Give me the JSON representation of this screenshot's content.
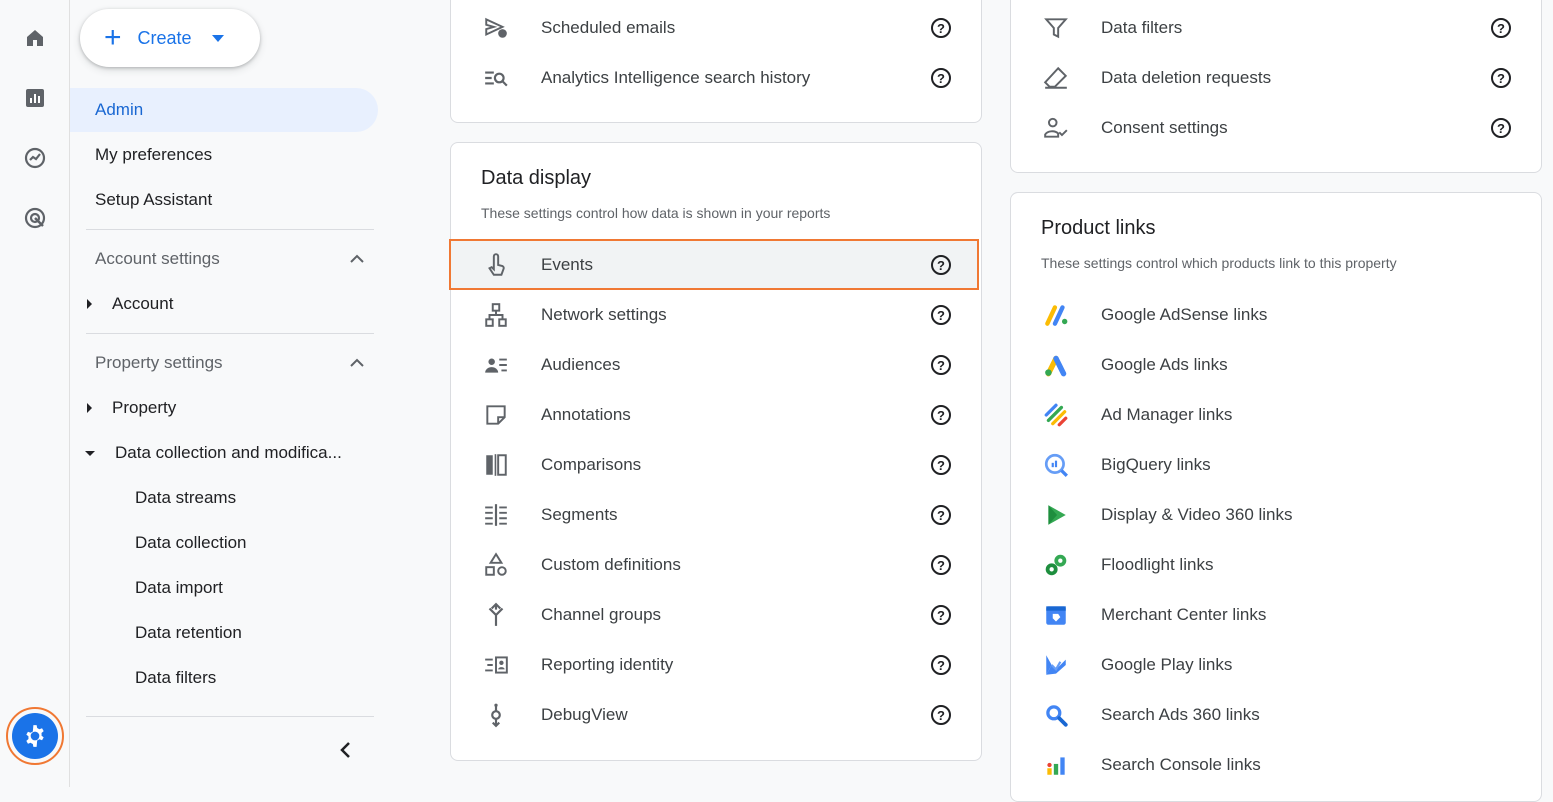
{
  "create": {
    "label": "Create"
  },
  "sidebar": {
    "admin": "Admin",
    "my_preferences": "My preferences",
    "setup_assistant": "Setup Assistant",
    "account_settings": "Account settings",
    "account": "Account",
    "property_settings": "Property settings",
    "property": "Property",
    "data_collection_mod": "Data collection and modifica...",
    "sub_items": [
      "Data streams",
      "Data collection",
      "Data import",
      "Data retention",
      "Data filters"
    ]
  },
  "middle_top": {
    "rows": [
      "Scheduled emails",
      "Analytics Intelligence search history"
    ]
  },
  "data_display": {
    "title": "Data display",
    "subtitle": "These settings control how data is shown in your reports",
    "rows": [
      "Events",
      "Network settings",
      "Audiences",
      "Annotations",
      "Comparisons",
      "Segments",
      "Custom definitions",
      "Channel groups",
      "Reporting identity",
      "DebugView"
    ]
  },
  "right_top": {
    "rows": [
      "Data filters",
      "Data deletion requests",
      "Consent settings"
    ]
  },
  "product_links": {
    "title": "Product links",
    "subtitle": "These settings control which products link to this property",
    "rows": [
      "Google AdSense links",
      "Google Ads links",
      "Ad Manager links",
      "BigQuery links",
      "Display & Video 360 links",
      "Floodlight links",
      "Merchant Center links",
      "Google Play links",
      "Search Ads 360 links",
      "Search Console links"
    ]
  },
  "help_glyph": "?",
  "colors": {
    "accent": "#1a73e8",
    "highlight": "#f07833"
  }
}
